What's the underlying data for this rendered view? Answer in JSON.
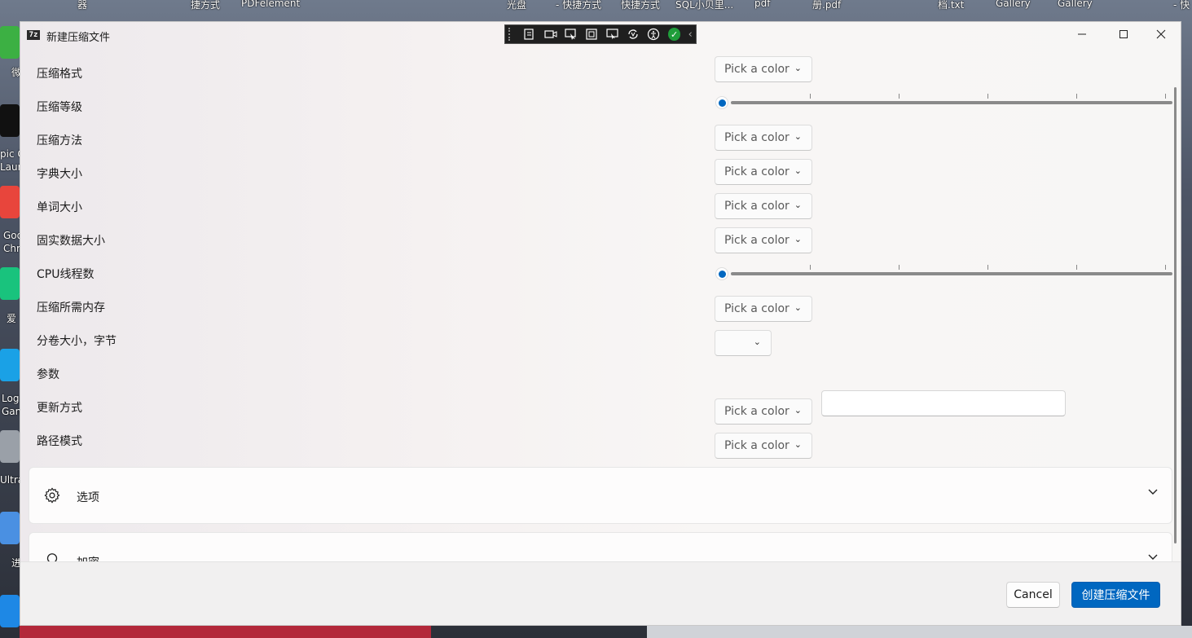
{
  "desktop": {
    "top_labels": [
      "器",
      "捷方式",
      "PDFelement",
      "光盘",
      "- 快捷方式",
      "快捷方式",
      "SQL小贝里...",
      "pdf",
      "册.pdf",
      "档.txt",
      "Gallery",
      "Gallery",
      "- 快"
    ],
    "left_labels": [
      "微",
      "pic G",
      "Laur",
      "Goo",
      "Chr",
      "爱",
      "Log",
      "Gam",
      "Ultra",
      "进"
    ]
  },
  "window": {
    "title": "新建压缩文件",
    "app_icon_text": "7z",
    "caption": {
      "minimize_icon": "minimize-icon",
      "maximize_icon": "maximize-icon",
      "close_icon": "close-icon"
    }
  },
  "debug_toolbar": {
    "icons": [
      "live-tree-icon",
      "video-icon",
      "select-element-icon",
      "layout-bounds-icon",
      "track-focus-icon",
      "hot-reload-icon",
      "accessibility-icon",
      "check-icon",
      "collapse-icon"
    ]
  },
  "form": {
    "rows": [
      {
        "label": "压缩格式",
        "control": "combo",
        "value": "Pick a color"
      },
      {
        "label": "压缩等级",
        "control": "slider",
        "level": 0
      },
      {
        "label": "压缩方法",
        "control": "combo",
        "value": "Pick a color"
      },
      {
        "label": "字典大小",
        "control": "combo",
        "value": "Pick a color"
      },
      {
        "label": "单词大小",
        "control": "combo",
        "value": "Pick a color"
      },
      {
        "label": "固实数据大小",
        "control": "combo",
        "value": "Pick a color"
      },
      {
        "label": "CPU线程数",
        "control": "slider",
        "level": 0
      },
      {
        "label": "压缩所需内存",
        "control": "combo",
        "value": "Pick a color"
      },
      {
        "label": "分卷大小，字节",
        "control": "combo-small",
        "value": ""
      },
      {
        "label": "参数",
        "control": "text",
        "value": ""
      },
      {
        "label": "更新方式",
        "control": "combo",
        "value": "Pick a color"
      },
      {
        "label": "路径模式",
        "control": "combo",
        "value": "Pick a color"
      }
    ]
  },
  "expanders": [
    {
      "label": "选项",
      "icon": "gear-icon",
      "expanded": false
    },
    {
      "label": "加密",
      "icon": "key-icon",
      "expanded": false
    }
  ],
  "footer": {
    "cancel_label": "Cancel",
    "create_label": "创建压缩文件"
  },
  "colors": {
    "accent": "#0067c0"
  }
}
